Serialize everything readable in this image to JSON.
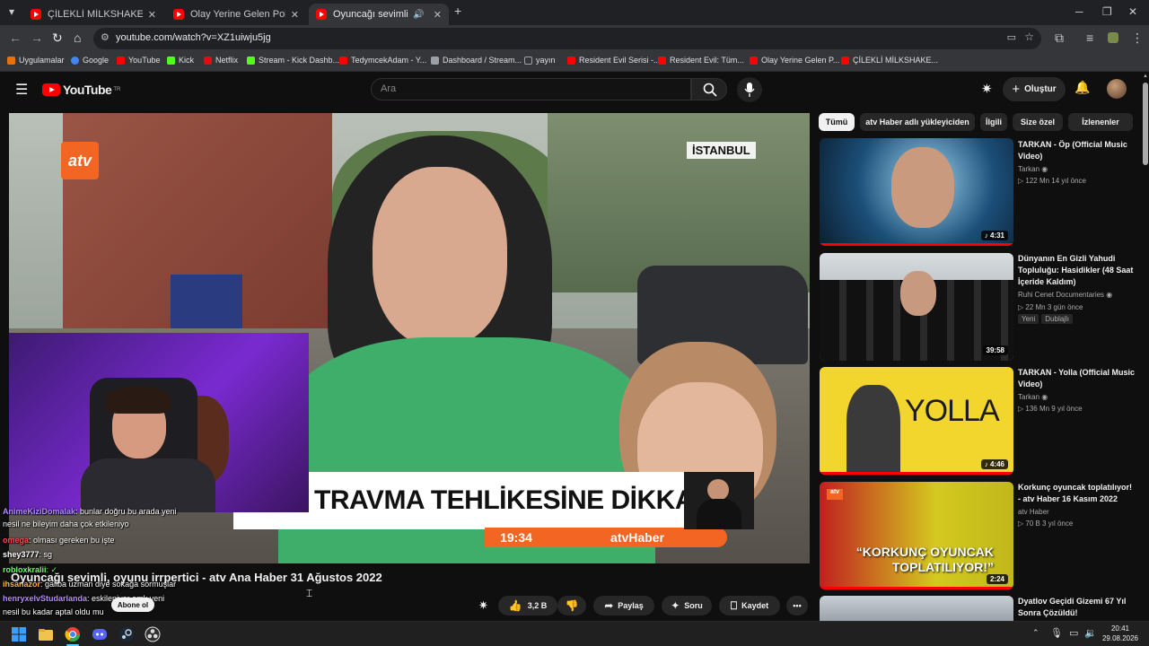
{
  "browser": {
    "tabs": [
      {
        "title": "ÇİLEKLİ MİLKSHAKE | Madara O...",
        "active": false
      },
      {
        "title": "Olay Yerine Gelen Polisler Hayat...",
        "active": false
      },
      {
        "title": "Oyuncağı sevimli, oyunu ür...",
        "active": true
      }
    ],
    "new_tab": "+",
    "url": "youtube.com/watch?v=XZ1uiwju5jg",
    "bookmarks": [
      {
        "label": "Uygulamalar",
        "color": "#e8710a"
      },
      {
        "label": "Google",
        "color": "#4285f4"
      },
      {
        "label": "YouTube",
        "color": "#ff0000"
      },
      {
        "label": "Kick",
        "color": "#53fc18"
      },
      {
        "label": "Netflix",
        "color": "#e50914"
      },
      {
        "label": "Stream - Kick Dashb...",
        "color": "#53fc18"
      },
      {
        "label": "TedymcekAdam - Y...",
        "color": "#ff0000"
      },
      {
        "label": "Dashboard / Stream...",
        "color": "#9aa0a6"
      },
      {
        "label": "yayın",
        "color": "#9aa0a6"
      },
      {
        "label": "Resident Evil Serisi -...",
        "color": "#ff0000"
      },
      {
        "label": "Resident Evil: Tüm...",
        "color": "#ff0000"
      },
      {
        "label": "Olay Yerine Gelen P...",
        "color": "#ff0000"
      },
      {
        "label": "ÇİLEKLİ MİLKSHAKE...",
        "color": "#ff0000"
      }
    ]
  },
  "youtube": {
    "logo": "YouTube",
    "logo_sup": "TR",
    "search_placeholder": "Ara",
    "create_label": "Oluştur",
    "video": {
      "title": "Oyuncağı sevimli, oyunu irrpertici - atv Ana Haber 31 Ağustos 2022",
      "location_tag": "İSTANBUL",
      "channel_logo": "atv",
      "lower_third": "TRAVMA TEHLİKESİNE DİKKAT",
      "clock": "19:34",
      "channel_tag": "atvHaber",
      "like_count": "3,2 B",
      "share_label": "Paylaş",
      "ask_label": "Soru",
      "save_label": "Kaydet",
      "subscribe_label": "Abone ol"
    },
    "chips": [
      {
        "label": "Tümü",
        "selected": true
      },
      {
        "label": "atv Haber adlı yükleyiciden",
        "selected": false
      },
      {
        "label": "İlgili",
        "selected": false
      },
      {
        "label": "Size özel",
        "selected": false
      },
      {
        "label": "İzlenenler",
        "selected": false
      }
    ],
    "recommendations": [
      {
        "title": "TARKAN - Öp (Official Music Video)",
        "channel": "Tarkan",
        "meta": "▷ 122 Mn  14 yıl önce",
        "duration": "♪ 4:31",
        "tags": [],
        "watched": 1.0
      },
      {
        "title": "Dünyanın En Gizli Yahudi Topluluğu: Hasidikler (48 Saat İçeride Kaldım)",
        "channel": "Ruhi Cenet Documentaries",
        "meta": "▷ 22 Mn  3 gün önce",
        "duration": "39:58",
        "tags": [
          "Yeni",
          "Dublajlı"
        ],
        "watched": 0
      },
      {
        "title": "TARKAN - Yolla (Official Music Video)",
        "channel": "Tarkan",
        "meta": "▷ 136 Mn  9 yıl önce",
        "duration": "♪ 4:46",
        "tags": [],
        "watched": 1.0,
        "thumb_text": "YOLLA"
      },
      {
        "title": "Korkunç oyuncak toplatılıyor! - atv Haber 16 Kasım 2022",
        "channel": "atv Haber",
        "meta": "▷ 70 B  3 yıl önce",
        "duration": "2:24",
        "tags": [],
        "watched": 1.0,
        "thumb_text": "“KORKUNÇ OYUNCAK TOPLATILIYOR!”"
      },
      {
        "title": "Dyatlov Geçidi Gizemi 67 Yıl Sonra Çözüldü!",
        "channel": "",
        "meta": "",
        "duration": "",
        "tags": [],
        "watched": 0
      }
    ]
  },
  "chat": [
    {
      "user": "AnimeKiziDomalak",
      "user_color": "#b58bff",
      "text": ": bunlar doğru bu arada yeni"
    },
    {
      "user": "",
      "user_color": "#ffffff",
      "text": "nesil ne bileyim daha çok etkileniyo"
    },
    {
      "user": "omega",
      "user_color": "#ff4d4d",
      "text": ": olması gereken bu işte"
    },
    {
      "user": "shey3777",
      "user_color": "#ffffff",
      "text": ": sg"
    },
    {
      "user": "robloxkralii",
      "user_color": "#6cff6c",
      "text": ": ✓"
    },
    {
      "user": "ihsanazor",
      "user_color": "#ffb347",
      "text": ": galiba uzman diye sokağa sormuşlar"
    },
    {
      "user": "henryxelvStudarlanda",
      "user_color": "#b58bff",
      "text": ": eskileniyor amk yeni"
    },
    {
      "user": "",
      "user_color": "#ffffff",
      "text": "nesil bu kadar aptal oldu mu"
    }
  ],
  "taskbar": {
    "time": "20:41",
    "date": "29.08.2026"
  }
}
